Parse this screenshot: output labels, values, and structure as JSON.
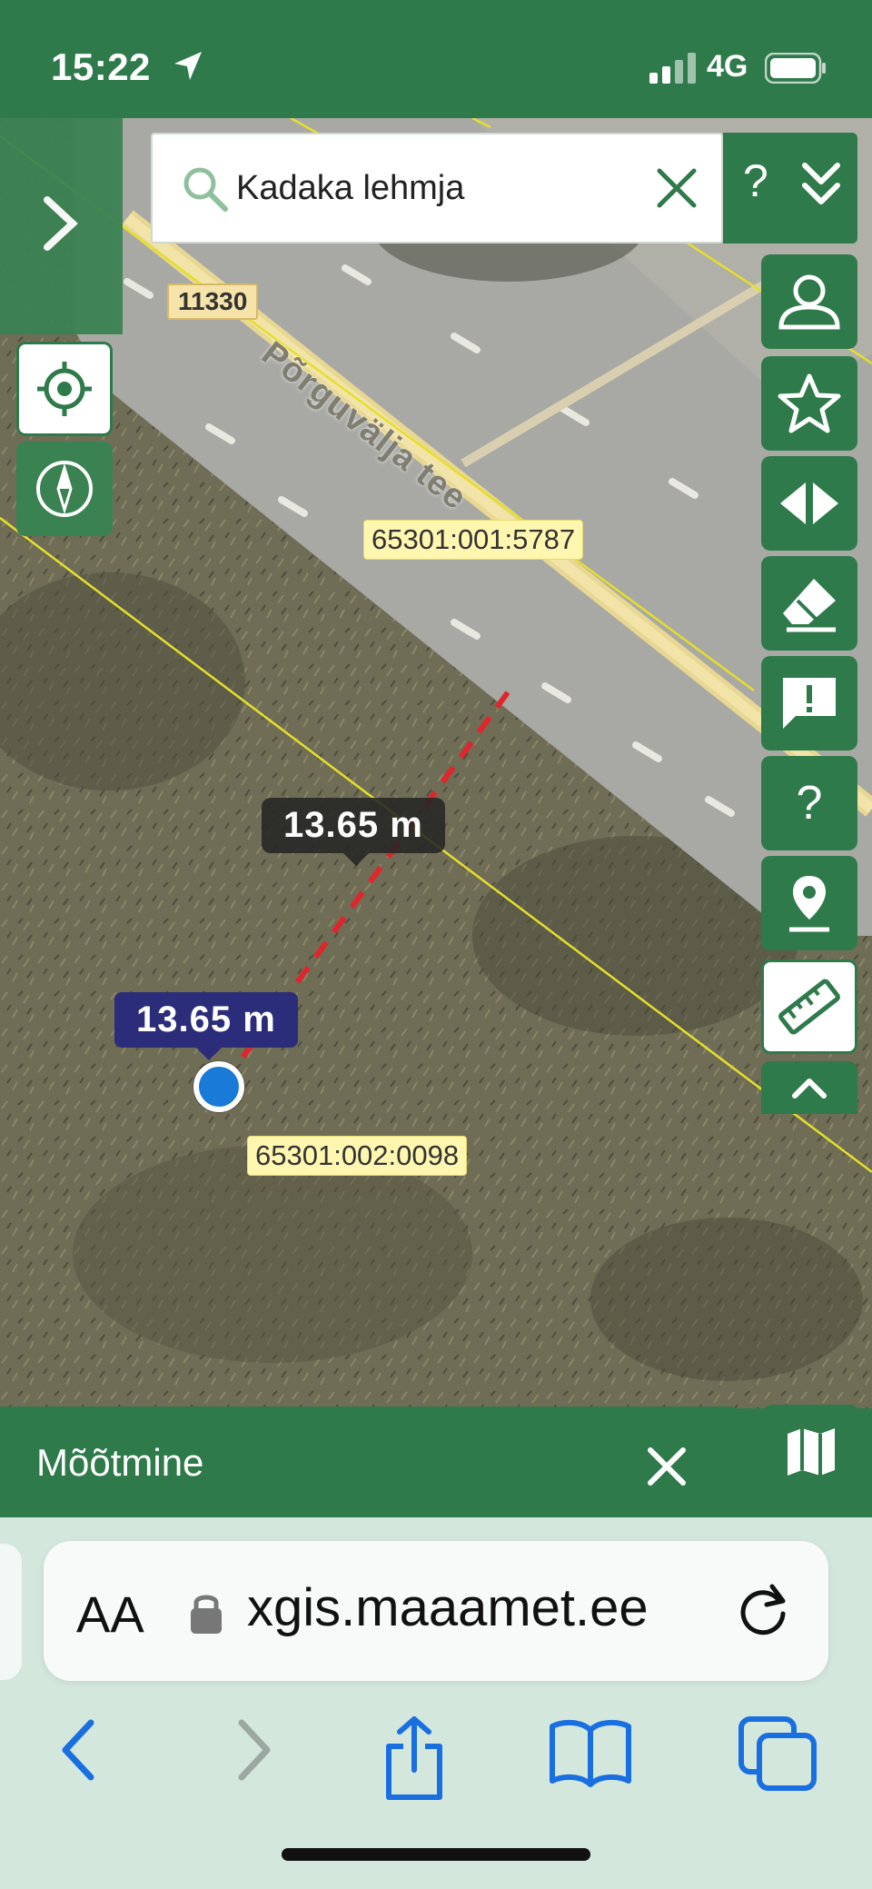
{
  "status_bar": {
    "time": "15:22",
    "network": "4G"
  },
  "search": {
    "value": "Kadaka lehmja",
    "help": "?"
  },
  "map": {
    "road_name": "Põrguvälja tee",
    "road_number": "11330",
    "parcels": [
      "65301:001:5787",
      "65301:002:0098"
    ],
    "measure_tooltip": "13.65 m",
    "measure_badge": "13.65 m"
  },
  "toolbar_icons": [
    "account-icon",
    "favorites-star-icon",
    "compare-arrows-icon",
    "eraser-icon",
    "feedback-icon",
    "help-icon",
    "place-marker-icon",
    "ruler-icon",
    "chevron-up-icon"
  ],
  "help_button_label": "?",
  "panel": {
    "title": "Mõõtmine"
  },
  "browser": {
    "text_size_label": "AA",
    "url": "xgis.maaamet.ee"
  },
  "colors": {
    "accent": "#2f7a4a",
    "measure_line": "#e0262c",
    "location_dot": "#1a7ad8",
    "badge": "#2c2d7a",
    "ios_blue": "#1a6fe0"
  }
}
